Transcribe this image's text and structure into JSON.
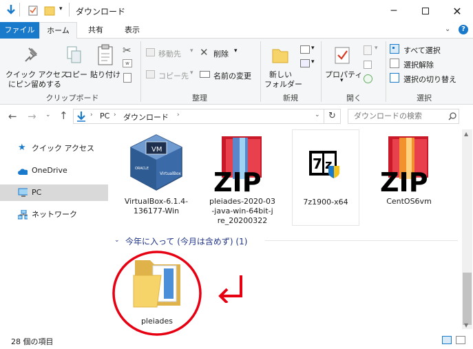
{
  "window": {
    "title": "ダウンロード"
  },
  "tabs": {
    "file": "ファイル",
    "home": "ホーム",
    "share": "共有",
    "view": "表示"
  },
  "ribbon": {
    "quick_access": "クイック アクセス",
    "pin_to": "にピン留めする",
    "copy": "コピー",
    "paste": "貼り付け",
    "clipboard_group": "クリップボード",
    "move_to": "移動先",
    "copy_to": "コピー先",
    "delete": "削除",
    "rename": "名前の変更",
    "organize_group": "整理",
    "new_folder_1": "新しい",
    "new_folder_2": "フォルダー",
    "new_group": "新規",
    "properties": "プロパティ",
    "open_group": "開く",
    "select_all": "すべて選択",
    "select_none": "選択解除",
    "invert_selection": "選択の切り替え",
    "select_group": "選択"
  },
  "address": {
    "segments": [
      "PC",
      "ダウンロード"
    ],
    "search_placeholder": "ダウンロードの検索"
  },
  "sidebar": {
    "items": [
      {
        "label": "クイック アクセス",
        "icon": "star-icon"
      },
      {
        "label": "OneDrive",
        "icon": "cloud-icon"
      },
      {
        "label": "PC",
        "icon": "computer-icon"
      },
      {
        "label": "ネットワーク",
        "icon": "network-icon"
      }
    ]
  },
  "files": [
    {
      "name_lines": [
        "VirtualBox-6.1.4-",
        "136177-Win"
      ],
      "icon": "virtualbox-icon"
    },
    {
      "name_lines": [
        "pleiades-2020-03",
        "-java-win-64bit-j",
        "re_20200322"
      ],
      "icon": "zip-folder-icon"
    },
    {
      "name_lines": [
        "7z1900-x64"
      ],
      "icon": "7zip-installer-icon"
    },
    {
      "name_lines": [
        "CentOS6vm"
      ],
      "icon": "zip-folder-icon"
    }
  ],
  "group": {
    "header": "今年に入って (今月は含めず) (1)"
  },
  "folder": {
    "name": "pleiades"
  },
  "status": {
    "count": "28 個の項目"
  },
  "colors": {
    "accent": "#1979ca",
    "annotation": "#e60012"
  }
}
